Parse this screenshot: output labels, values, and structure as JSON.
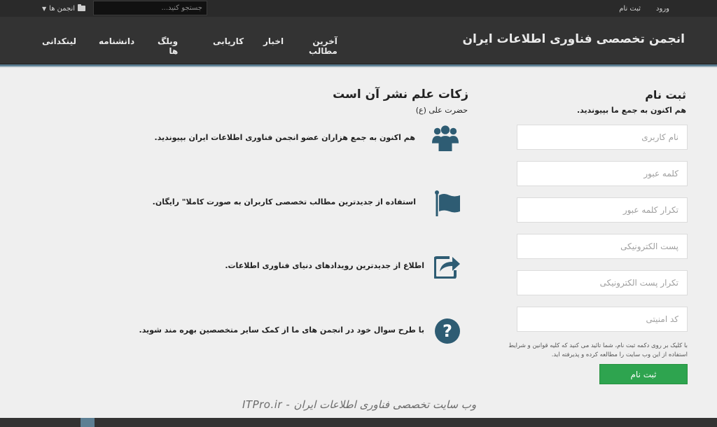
{
  "topbar": {
    "login": "ورود",
    "signup": "ثبت نام",
    "search_placeholder": "جستجو کنید...",
    "forums_label": "انجمن ها"
  },
  "header": {
    "site_title": "انجمن تخصصی فناوری اطلاعات ایران",
    "nav": [
      "آخرین مطالب",
      "اخبار",
      "کاریابی",
      "وبلگ ها",
      "دانشنامه",
      "لینکدانی"
    ]
  },
  "registration": {
    "title": "ثبت نام",
    "subtitle": "هم اکنون به جمع ما بپیوندید.",
    "fields": {
      "username": "نام کاربری",
      "password": "کلمه عبور",
      "password_repeat": "تکرار کلمه عبور",
      "email": "پست الکترونیکی",
      "email_repeat": "تکرار پست الکترونیکی",
      "captcha": "کد امنیتی"
    },
    "terms": "با کلیک بر روی دکمه ثبت نام، شما تائید می کنید که کلیه قوانین و شرایط استفاده از این وب سایت را مطالعه کرده و پذیرفته اید.",
    "submit": "ثبت نام"
  },
  "features": {
    "quote": "زکات علم نشر آن است",
    "quote_source": "حضرت علی (ع)",
    "items": [
      {
        "icon": "users-icon",
        "text": "هم اکنون به جمع هزاران عضو انجمن فناوری اطلاعات ایران بپیوندید."
      },
      {
        "icon": "flag-icon",
        "text": "استفاده از جدیدترین مطالب تخصصی کاربران به صورت کاملا\" رایگان."
      },
      {
        "icon": "share-icon",
        "text": "اطلاع از جدیدترین رویدادهای دنیای فناوری اطلاعات."
      },
      {
        "icon": "question-icon",
        "text": "با طرح سوال خود در انجمن های ما از کمک سایر متخصصین بهره مند شوید."
      }
    ]
  },
  "watermark": "ITPro.ir - وب سایت تخصصی فناوری اطلاعات ایران",
  "colors": {
    "accent": "#2e5c73",
    "register_button": "#2ea44f",
    "header_bg": "#333333"
  }
}
